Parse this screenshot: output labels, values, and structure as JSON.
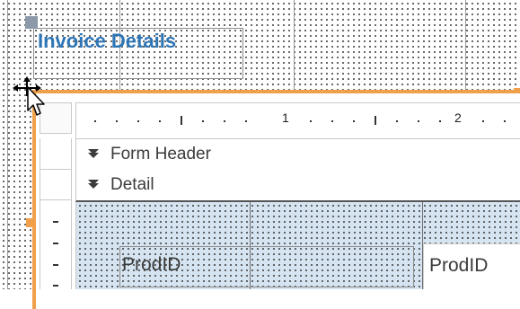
{
  "title_label": "Invoice Details",
  "ruler": {
    "numbers": [
      "1",
      "2"
    ]
  },
  "sections": {
    "form_header": "Form Header",
    "detail": "Detail"
  },
  "fields": {
    "label": "ProdID",
    "textbox": "ProdID"
  },
  "colors": {
    "accent": "#f0a04b",
    "title_text": "#2e75b6",
    "detail_bg": "#d6e4f1"
  },
  "icons": [
    "move-handle-icon",
    "mouse-pointer-icon",
    "section-expand-arrow-icon"
  ]
}
